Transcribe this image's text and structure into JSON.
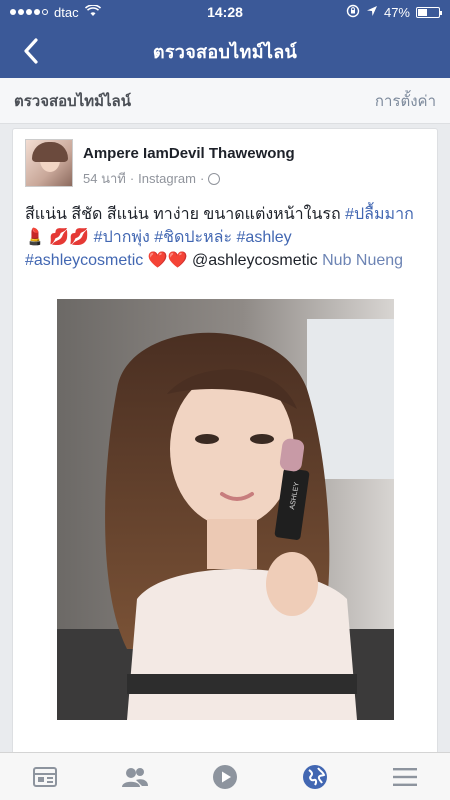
{
  "status_bar": {
    "carrier": "dtac",
    "time": "14:28",
    "battery_text": "47%",
    "battery_level": 0.47,
    "icons": [
      "signal-icon",
      "wifi-icon",
      "rotation-lock-icon",
      "location-arrow-icon",
      "battery-icon"
    ]
  },
  "nav": {
    "title": "ตรวจสอบไทม์ไลน์",
    "back_icon": "chevron-left-icon"
  },
  "section": {
    "title": "ตรวจสอบไทม์ไลน์",
    "settings_label": "การตั้งค่า"
  },
  "post": {
    "author": "Ampere IamDevil Thawewong",
    "time": "54 นาที",
    "separator": "·",
    "source": "Instagram",
    "source_separator": "·",
    "text_plain": "สีแน่น สีชัด สีแน่น ทาง่าย ขนาดแต่งหน้าในรถ ",
    "hashtag_1": "#ปลื้มมาก",
    "emoji_1": "💄 💋💋",
    "hashtag_2": "#ปากพุ่ง",
    "hashtag_3": "#ชิดปะหล่ะ",
    "hashtag_4": "#ashley",
    "hashtag_5": "#ashleycosmetic",
    "emoji_2": "❤️❤️",
    "mention": "@ashleycosmetic",
    "tail": "Nub Nueng",
    "photo_text": "ASHLEY"
  },
  "tabbar": {
    "items": [
      {
        "name": "news-feed",
        "icon": "news-feed-icon"
      },
      {
        "name": "friends",
        "icon": "friends-icon"
      },
      {
        "name": "video",
        "icon": "play-icon"
      },
      {
        "name": "notifications",
        "icon": "globe-icon"
      },
      {
        "name": "menu",
        "icon": "menu-icon"
      }
    ],
    "active_color": "#4267b2",
    "inactive_color": "#8d949e"
  },
  "colors": {
    "brand_blue": "#3b5998",
    "link_blue": "#4267b2",
    "heart_red": "#e0245e"
  }
}
